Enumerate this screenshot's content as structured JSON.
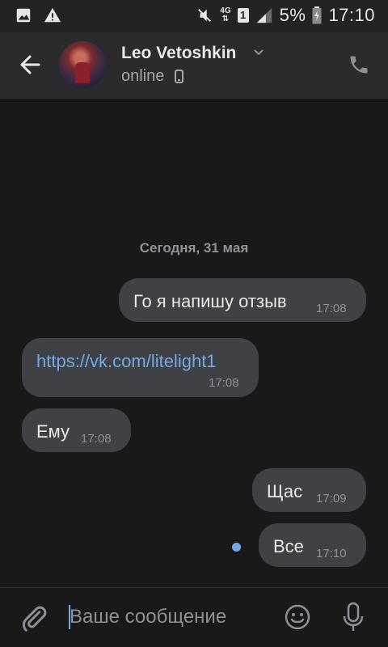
{
  "status_bar": {
    "network": "4G",
    "sim": "1",
    "battery": "5%",
    "time": "17:10",
    "icons": [
      "image-icon",
      "warning-icon",
      "mute-icon",
      "signal-icon",
      "battery-icon"
    ]
  },
  "header": {
    "contact_name": "Leo Vetoshkin",
    "status": "online"
  },
  "chat": {
    "date_separator": "Сегодня, 31 мая",
    "messages": [
      {
        "text": "Го я напишу отзыв",
        "time": "17:08",
        "outgoing": true
      },
      {
        "text": "https://vk.com/litelight1",
        "time": "17:08",
        "outgoing": false
      },
      {
        "text": "Ему",
        "time": "17:08",
        "outgoing": false
      },
      {
        "text": "Щас",
        "time": "17:09",
        "outgoing": true
      },
      {
        "text": "Все",
        "time": "17:10",
        "outgoing": true,
        "unread": true
      }
    ]
  },
  "composer": {
    "placeholder": "Ваше сообщение"
  },
  "colors": {
    "background": "#19191a",
    "header": "#2b2b2e",
    "bubble": "#404144",
    "link": "#71aaeb",
    "muted_text": "#8d9196"
  }
}
